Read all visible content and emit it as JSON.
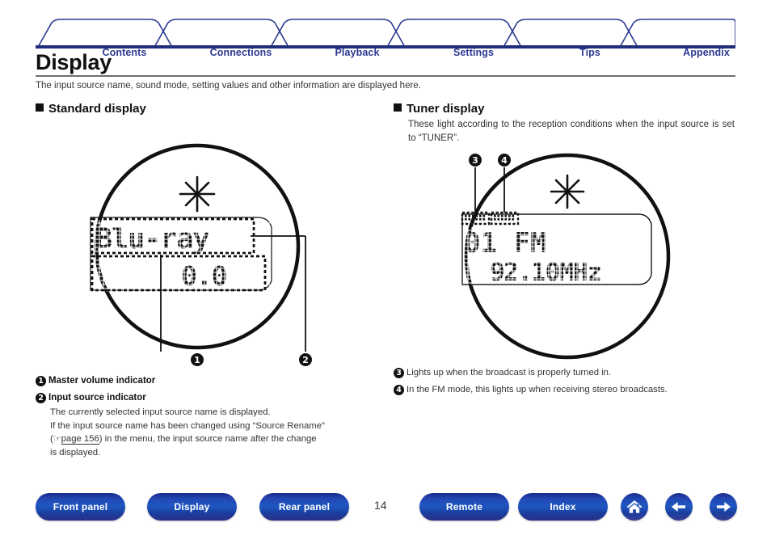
{
  "nav_tabs": [
    {
      "label": "Contents"
    },
    {
      "label": "Connections"
    },
    {
      "label": "Playback"
    },
    {
      "label": "Settings"
    },
    {
      "label": "Tips"
    },
    {
      "label": "Appendix"
    }
  ],
  "page": {
    "title": "Display",
    "lede": "The input source name, sound mode, setting values and other information are displayed here.",
    "number": "14"
  },
  "sections": {
    "standard": {
      "heading": "Standard display",
      "display": {
        "line1": "Blu-ray",
        "line2": "0.0"
      },
      "callouts": [
        "1",
        "2"
      ],
      "notes": [
        {
          "num": "1",
          "title": "Master volume indicator",
          "body": ""
        },
        {
          "num": "2",
          "title": "Input source indicator",
          "body_line1": "The currently selected input source name is displayed.",
          "body_line2": "If the input source name has been changed using “Source Rename”",
          "body_line3_pre": "(",
          "body_link": "page 156",
          "body_line3_post": ") in the menu, the input source name after the change",
          "body_line4": "is displayed."
        }
      ]
    },
    "tuner": {
      "heading": "Tuner display",
      "sub": "These light according to the reception conditions when the input source is set to “TUNER”.",
      "display": {
        "line1": "01 FM",
        "line2": "92.10MHz"
      },
      "callouts": [
        "3",
        "4"
      ],
      "notes": [
        {
          "num": "3",
          "text": "Lights up when the broadcast is properly turned in."
        },
        {
          "num": "4",
          "text": "In the FM mode, this lights up when receiving stereo broadcasts."
        }
      ]
    }
  },
  "footer": {
    "buttons": [
      {
        "label": "Front panel"
      },
      {
        "label": "Display"
      },
      {
        "label": "Rear panel"
      },
      {
        "label": "Remote"
      },
      {
        "label": "Index"
      }
    ],
    "icons": [
      {
        "name": "home-icon"
      },
      {
        "name": "arrow-left-icon"
      },
      {
        "name": "arrow-right-icon"
      }
    ]
  },
  "colors": {
    "brand_blue": "#2b3990",
    "rule_blue": "#1f2d7b",
    "rule_gray": "#6d6e71"
  }
}
